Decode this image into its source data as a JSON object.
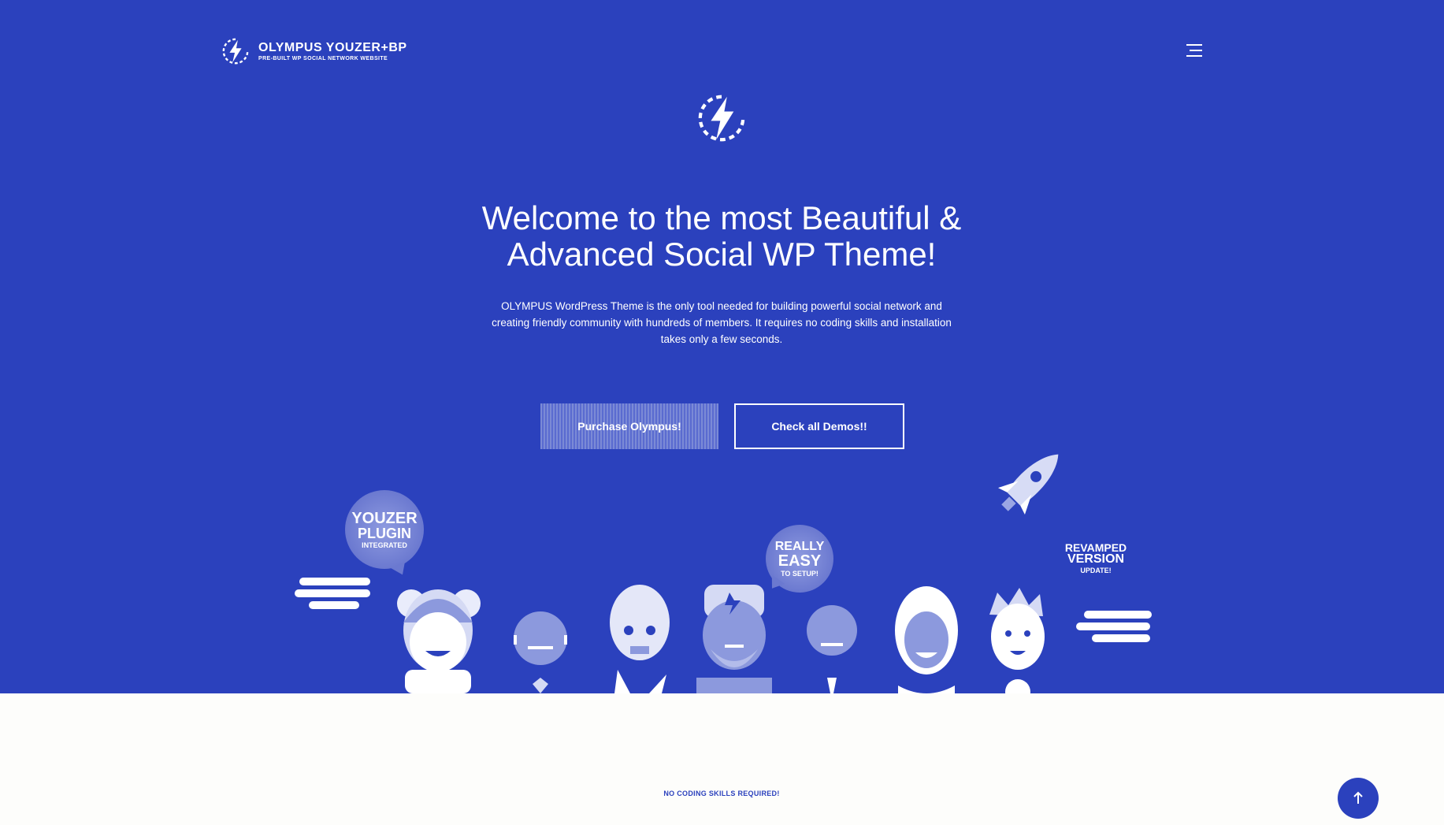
{
  "brand": {
    "title": "OLYMPUS YOUZER+BP",
    "subtitle": "PRE-BUILT WP SOCIAL NETWORK WEBSITE"
  },
  "hero": {
    "headline_line1": "Welcome to the most Beautiful &",
    "headline_line2": "Advanced Social WP Theme!",
    "lead_line1": "OLYMPUS WordPress Theme is the only tool needed for building powerful social network and",
    "lead_line2": "creating friendly community with hundreds of members. It requires no coding skills and installation",
    "lead_line3": "takes only a few seconds.",
    "purchase_label": "Purchase Olympus!",
    "demos_label": "Check all Demos!!"
  },
  "badges": {
    "youzer": {
      "l1": "YOUZER",
      "l2": "PLUGIN",
      "l3": "INTEGRATED"
    },
    "easy": {
      "l1": "REALLY",
      "l2": "EASY",
      "l3": "TO SETUP!"
    },
    "revamped": {
      "l1": "REVAMPED",
      "l2": "VERSION",
      "l3": "UPDATE!"
    }
  },
  "section": {
    "label": "NO CODING SKILLS REQUIRED!"
  },
  "icons": {
    "menu": "menu-icon",
    "logo": "bolt-icon",
    "to_top": "arrow-up-icon"
  },
  "colors": {
    "primary": "#2b41bd",
    "white": "#ffffff",
    "page_bg": "#fdfdfb"
  }
}
